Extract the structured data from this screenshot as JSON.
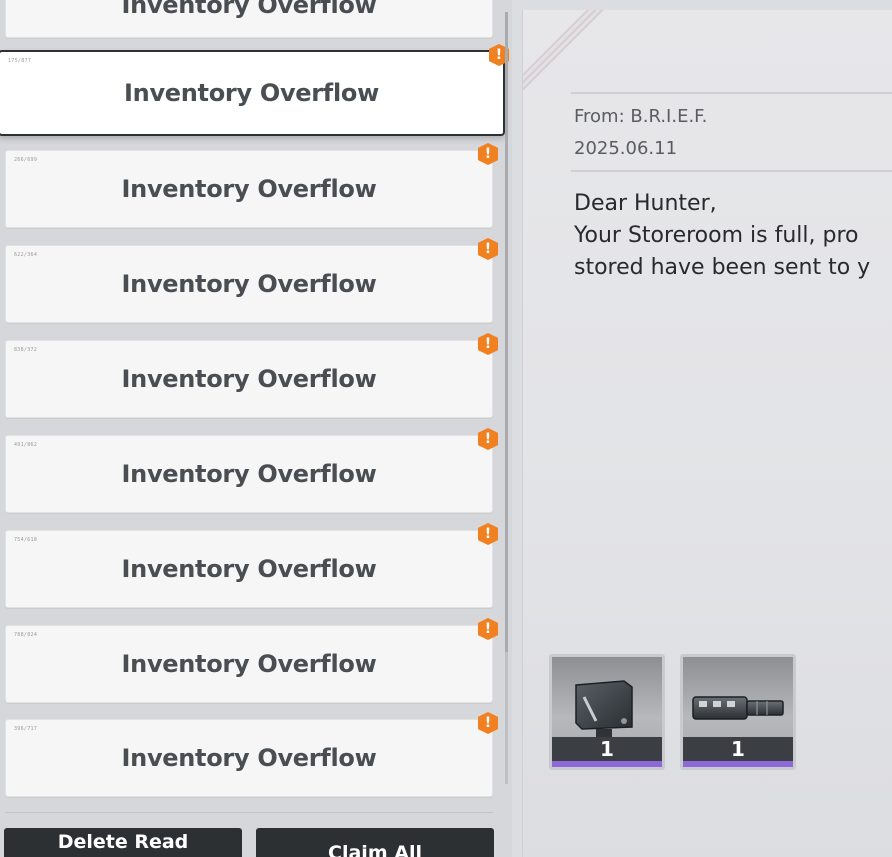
{
  "mail_list": {
    "items": [
      {
        "code": "",
        "title": "Inventory Overflow"
      },
      {
        "code": "175/877",
        "title": "Inventory Overflow",
        "selected": true
      },
      {
        "code": "266/699",
        "title": "Inventory Overflow"
      },
      {
        "code": "622/364",
        "title": "Inventory Overflow"
      },
      {
        "code": "838/372",
        "title": "Inventory Overflow"
      },
      {
        "code": "491/862",
        "title": "Inventory Overflow"
      },
      {
        "code": "754/618",
        "title": "Inventory Overflow"
      },
      {
        "code": "788/824",
        "title": "Inventory Overflow"
      },
      {
        "code": "396/717",
        "title": "Inventory Overflow"
      }
    ],
    "alert_glyph": "!"
  },
  "buttons": {
    "delete_read": "Delete Read",
    "claim_all": "Claim All"
  },
  "mail": {
    "from": "From: B.R.I.E.F.",
    "date": "2025.06.11",
    "greeting": "Dear Hunter,",
    "body_line1": "Your Storeroom is full, pro",
    "body_line2": "stored have been sent to y"
  },
  "attachments": [
    {
      "icon": "weapon-mod-block-icon",
      "quantity": "1"
    },
    {
      "icon": "muzzle-brake-icon",
      "quantity": "1"
    }
  ],
  "colors": {
    "alert": "#f08020",
    "button_bg": "#2c3033",
    "rarity": "#8d6ad8"
  }
}
